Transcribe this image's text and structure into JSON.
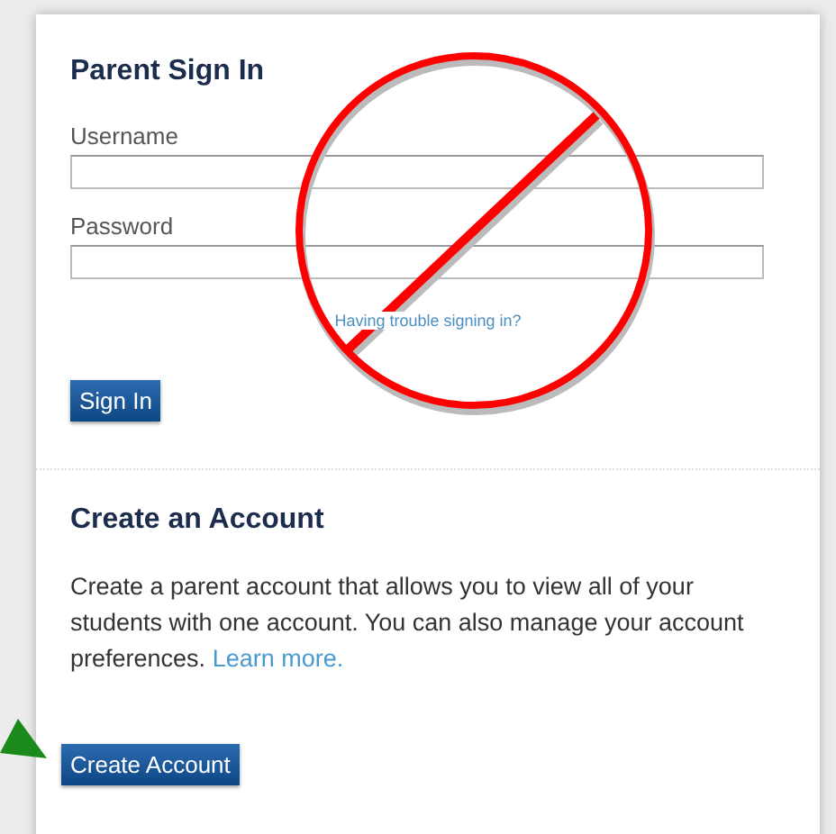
{
  "sign_in": {
    "title": "Parent Sign In",
    "fields": [
      {
        "label": "Username"
      },
      {
        "label": "Password"
      }
    ],
    "help_link": "Having trouble signing in?",
    "button": "Sign In"
  },
  "create_account": {
    "title": "Create an Account",
    "description": "Create a parent account that allows you to view all of your students with one account. You can also manage your account preferences.",
    "link": "Learn more.",
    "button": "Create Account"
  }
}
